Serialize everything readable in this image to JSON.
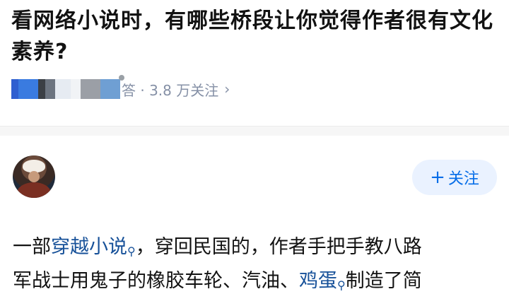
{
  "question": {
    "title": "看网络小说时，有哪些桥段让你觉得作者很有文化素养?",
    "meta_suffix": "答 · 3.8 万关注",
    "meta_chevron": "›",
    "pixel_colors": [
      "#2f5fd0",
      "#3a7be0",
      "#3b3f45",
      "#6c7480",
      "#e6ebf2",
      "#f1f3f6",
      "#9b9fa6",
      "#6f9fd3"
    ]
  },
  "answer": {
    "follow_label": "关注",
    "follow_plus": "+",
    "content": {
      "line1_pre": "一部",
      "link1": "穿越小说",
      "line1_post": "，穿回民国的，作者手把手教八路",
      "line2_pre": "军战士用鬼子的橡胶车轮、汽油、",
      "link2": "鸡蛋",
      "line2_post": "制造了简",
      "search_icon": "search-icon"
    },
    "accent_color": "#056de8"
  }
}
